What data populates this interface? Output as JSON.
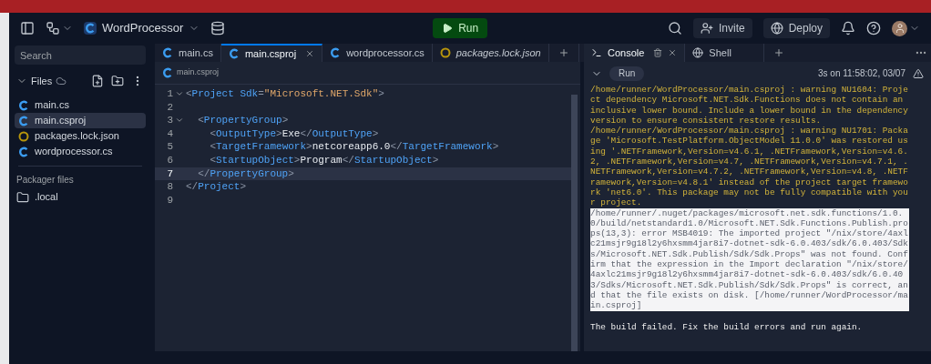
{
  "header": {
    "project": "WordProcessor",
    "run": "Run",
    "invite": "Invite",
    "deploy": "Deploy"
  },
  "sidebar": {
    "search": {
      "placeholder": "Search"
    },
    "files_title": "Files",
    "files": [
      {
        "name": "main.cs",
        "kind": "csharp",
        "selected": false
      },
      {
        "name": "main.csproj",
        "kind": "csharp",
        "selected": true
      },
      {
        "name": "packages.lock.json",
        "kind": "json",
        "selected": false
      },
      {
        "name": "wordprocessor.cs",
        "kind": "csharp",
        "selected": false
      }
    ],
    "packager_title": "Packager files",
    "packager_items": [
      {
        "name": ".local",
        "kind": "folder"
      }
    ]
  },
  "editor": {
    "tabs": [
      {
        "label": "main.cs",
        "kind": "csharp",
        "selected": false,
        "italic": false
      },
      {
        "label": "main.csproj",
        "kind": "csharp",
        "selected": true,
        "italic": false
      },
      {
        "label": "wordprocessor.cs",
        "kind": "csharp",
        "selected": false,
        "italic": false
      },
      {
        "label": "packages.lock.json",
        "kind": "json",
        "selected": false,
        "italic": true
      }
    ],
    "breadcrumb": "main.csproj",
    "lines": [
      {
        "number": "1",
        "foldable": true,
        "current": false,
        "code": "<Project Sdk=\"Microsoft.NET.Sdk\">"
      },
      {
        "number": "2",
        "foldable": false,
        "current": false
      },
      {
        "number": "3",
        "foldable": true,
        "current": false,
        "code": "  <PropertyGroup>"
      },
      {
        "number": "4",
        "foldable": false,
        "current": false,
        "code": "    <OutputType>Exe</OutputType>"
      },
      {
        "number": "5",
        "foldable": false,
        "current": false,
        "code": "    <TargetFramework>netcoreapp6.0</TargetFramework>"
      },
      {
        "number": "6",
        "foldable": false,
        "current": false,
        "code": "    <StartupObject>Program</StartupObject>"
      },
      {
        "number": "7",
        "foldable": false,
        "current": true,
        "code": "  </PropertyGroup>"
      },
      {
        "number": "8",
        "foldable": false,
        "current": false,
        "code": "</Project>"
      },
      {
        "number": "9",
        "foldable": false,
        "current": false
      }
    ]
  },
  "console": {
    "tabs": [
      {
        "label": "Console",
        "kind": "console",
        "selected": true
      },
      {
        "label": "Shell",
        "kind": "shell",
        "selected": false
      }
    ],
    "run": "Run",
    "status": "3s on 11:58:02, 03/07",
    "output": [
      {
        "kind": "warning",
        "text": "/home/runner/WordProcessor/main.csproj : warning NU1604: Project dependency Microsoft.NET.Sdk.Functions does not contain an inclusive lower bound. Include a lower bound in the dependency version to ensure consistent restore results."
      },
      {
        "kind": "warning",
        "text": "/home/runner/WordProcessor/main.csproj : warning NU1701: Package 'Microsoft.TestPlatform.ObjectModel 11.0.0' was restored using '.NETFramework,Version=v4.6.1, .NETFramework,Version=v4.6.2, .NETFramework,Version=v4.7, .NETFramework,Version=v4.7.1, .NETFramework,Version=v4.7.2, .NETFramework,Version=v4.8, .NETFramework,Version=v4.8.1' instead of the project target framework 'net6.0'. This package may not be fully compatible with your project."
      },
      {
        "kind": "error",
        "text": "/home/runner/.nuget/packages/microsoft.net.sdk.functions/1.0.0/build/netstandard1.0/Microsoft.NET.Sdk.Functions.Publish.props(13,3): error MSB4019: The imported project \"/nix/store/4axlc21msjr9g18l2y6hxsmm4jar8i7-dotnet-sdk-6.0.403/sdk/6.0.403/Sdks/Microsoft.NET.Sdk.Publish/Sdk/Sdk.Props\" was not found. Confirm that the expression in the Import declaration \"/nix/store/4axlc21msjr9g18l2y6hxsmm4jar8i7-dotnet-sdk-6.0.403/sdk/6.0.403/Sdks/Microsoft.NET.Sdk.Publish/Sdk/Sdk.Props\" is correct, and that the file exists on disk. [/home/runner/WordProcessor/main.csproj]"
      },
      {
        "kind": "info",
        "text": "The build failed. Fix the build errors and run again."
      }
    ]
  }
}
